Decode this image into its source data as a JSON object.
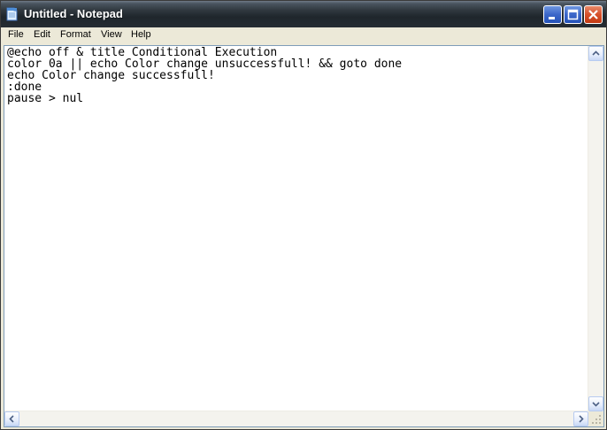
{
  "window": {
    "title": "Untitled - Notepad"
  },
  "menu": {
    "items": [
      "File",
      "Edit",
      "Format",
      "View",
      "Help"
    ]
  },
  "editor": {
    "lines": [
      "@echo off & title Conditional Execution",
      "color 0a || echo Color change unsuccessfull! && goto done",
      "echo Color change successfull!",
      ":done",
      "pause > nul"
    ]
  },
  "colors": {
    "titlebar": "#2a3137",
    "chrome": "#ece9d8",
    "close_button": "#d7502a",
    "caption_button": "#3b66c9",
    "editor_background": "#ffffff"
  },
  "icons": {
    "app": "notepad-icon",
    "minimize": "minimize-icon",
    "maximize": "maximize-icon",
    "close": "close-icon",
    "scroll_up": "arrow-up-icon",
    "scroll_down": "arrow-down-icon",
    "scroll_left": "arrow-left-icon",
    "scroll_right": "arrow-right-icon",
    "resize": "resize-grip-icon"
  }
}
